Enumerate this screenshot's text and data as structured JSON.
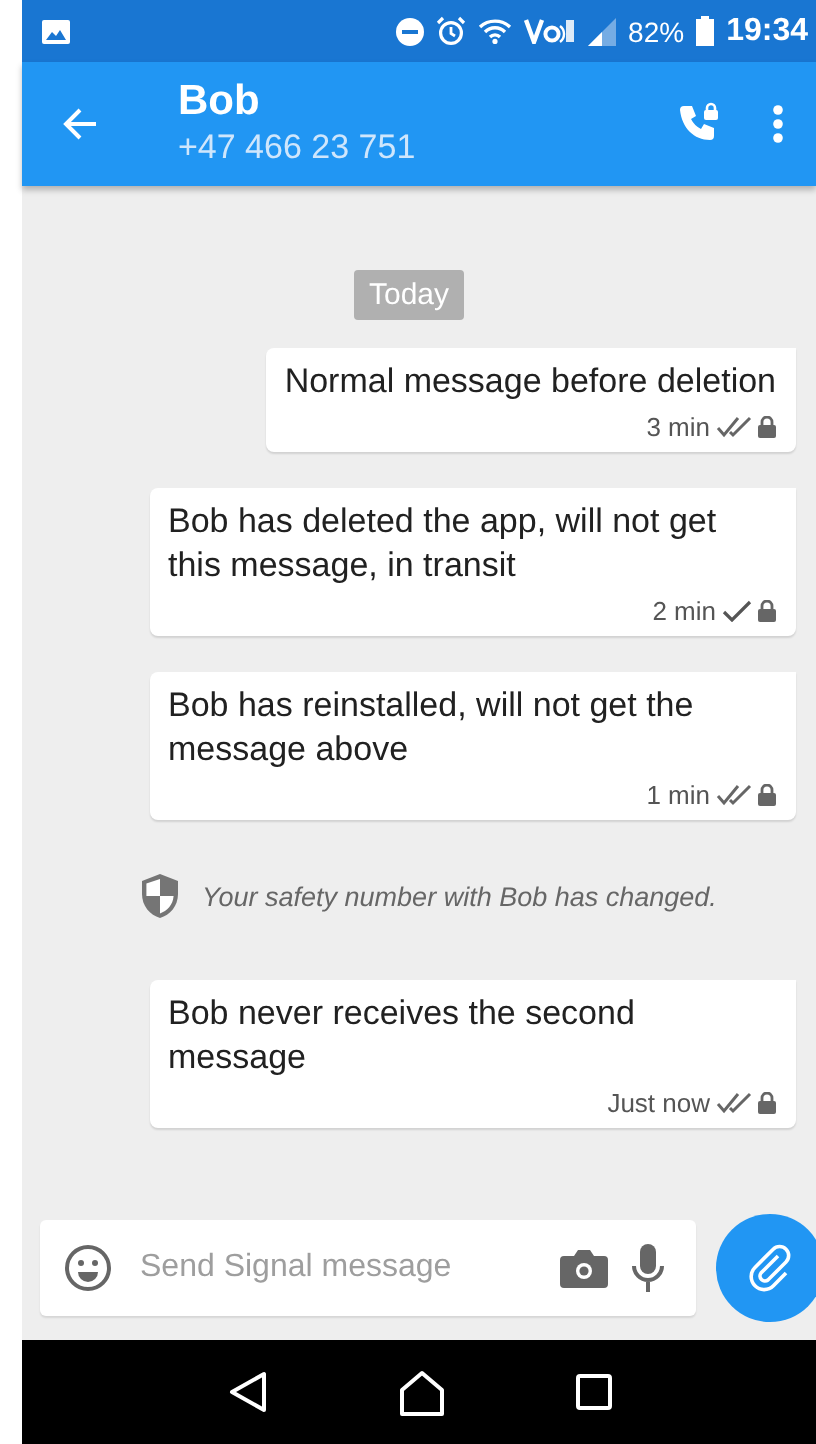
{
  "status_bar": {
    "battery": "82%",
    "time": "19:34"
  },
  "header": {
    "name": "Bob",
    "phone": "+47 466 23 751"
  },
  "date_divider": "Today",
  "items": [
    {
      "kind": "message",
      "text": "Normal message before deletion",
      "time": "3 min",
      "delivered": true
    },
    {
      "kind": "message",
      "text": "Bob has deleted the app, will not get this message, in transit",
      "time": "2 min",
      "delivered": false
    },
    {
      "kind": "message",
      "text": "Bob has reinstalled, will not get the message above",
      "time": "1 min",
      "delivered": true
    },
    {
      "kind": "notice",
      "text": "Your safety number with Bob has changed."
    },
    {
      "kind": "message",
      "text": "Bob never receives the second message",
      "time": "Just now",
      "delivered": true
    }
  ],
  "composer": {
    "placeholder": "Send Signal message"
  }
}
